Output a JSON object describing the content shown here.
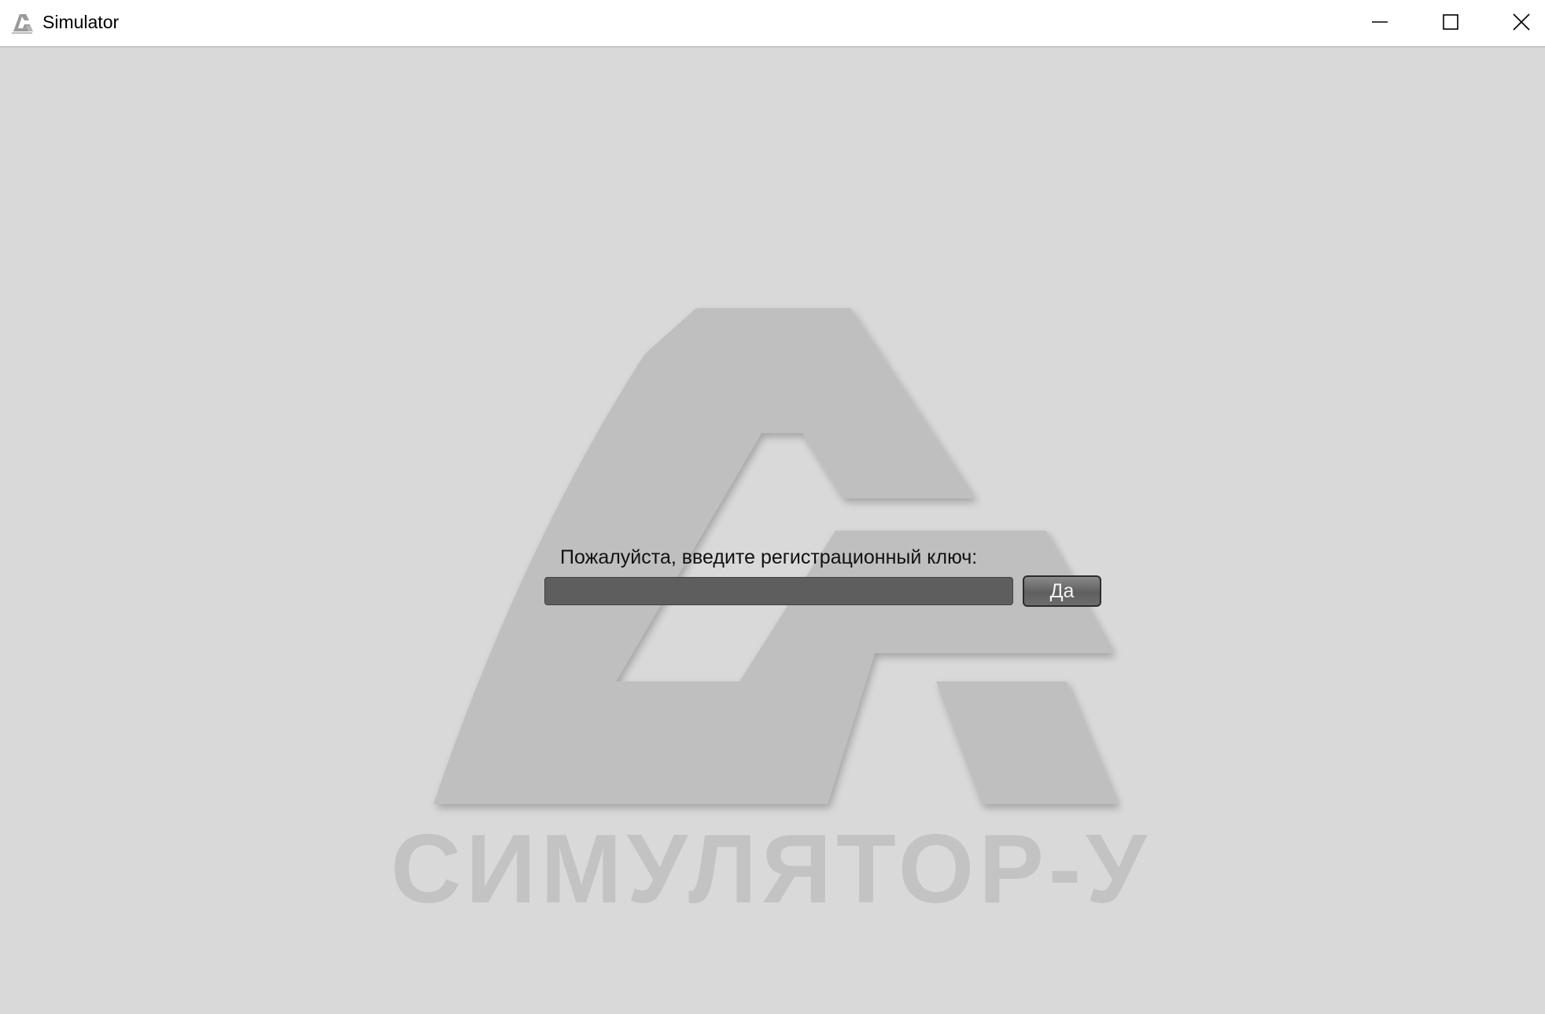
{
  "window": {
    "title": "Simulator"
  },
  "titlebar_icons": {
    "app": "app-logo-icon",
    "minimize": "minimize-icon",
    "maximize": "maximize-icon",
    "close": "close-icon"
  },
  "logo": {
    "text": "СИМУЛЯТОР-У",
    "color": "#bfbfbf"
  },
  "registration": {
    "prompt": "Пожалуйста, введите регистрационный ключ:",
    "key_value": "",
    "confirm_label": "Да"
  },
  "colors": {
    "background": "#d9d9d9",
    "input_bg": "#5b5b5b",
    "button_bg": "#6e6e6e"
  }
}
